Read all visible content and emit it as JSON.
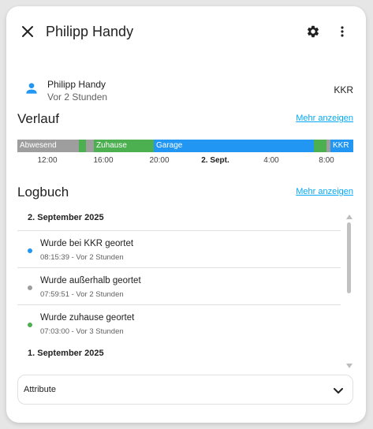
{
  "header": {
    "title": "Philipp Handy"
  },
  "entity": {
    "name": "Philipp Handy",
    "last_changed": "Vor 2 Stunden",
    "state": "KKR",
    "icon": "account-icon"
  },
  "history": {
    "title": "Verlauf",
    "more_link": "Mehr anzeigen",
    "segments": [
      {
        "label": "Abwesend",
        "color": "#9e9e9e"
      },
      {
        "label": "",
        "color": "#4caf50"
      },
      {
        "label": "",
        "color": "#9e9e9e"
      },
      {
        "label": "Zuhause",
        "color": "#4caf50"
      },
      {
        "label": "Garage",
        "color": "#2196f3"
      },
      {
        "label": "",
        "color": "#4caf50"
      },
      {
        "label": "",
        "color": "#9e9e9e"
      },
      {
        "label": "KKR",
        "color": "#2196f3"
      }
    ],
    "ticks": [
      "12:00",
      "16:00",
      "20:00",
      "2. Sept.",
      "4:00",
      "8:00"
    ]
  },
  "logbook": {
    "title": "Logbuch",
    "more_link": "Mehr anzeigen",
    "groups": [
      {
        "date": "2. September 2025",
        "entries": [
          {
            "message": "Wurde bei KKR geortet",
            "time": "08:15:39 - Vor 2 Stunden",
            "color": "#2196f3"
          },
          {
            "message": "Wurde außerhalb geortet",
            "time": "07:59:51 - Vor 2 Stunden",
            "color": "#9e9e9e"
          },
          {
            "message": "Wurde zuhause geortet",
            "time": "07:03:00 - Vor 3 Stunden",
            "color": "#4caf50"
          }
        ]
      },
      {
        "date": "1. September 2025",
        "entries": []
      }
    ]
  },
  "attributes": {
    "label": "Attribute"
  },
  "colors": {
    "accent": "#03a9f4",
    "present": "#4caf50",
    "away": "#9e9e9e",
    "zone": "#2196f3"
  }
}
